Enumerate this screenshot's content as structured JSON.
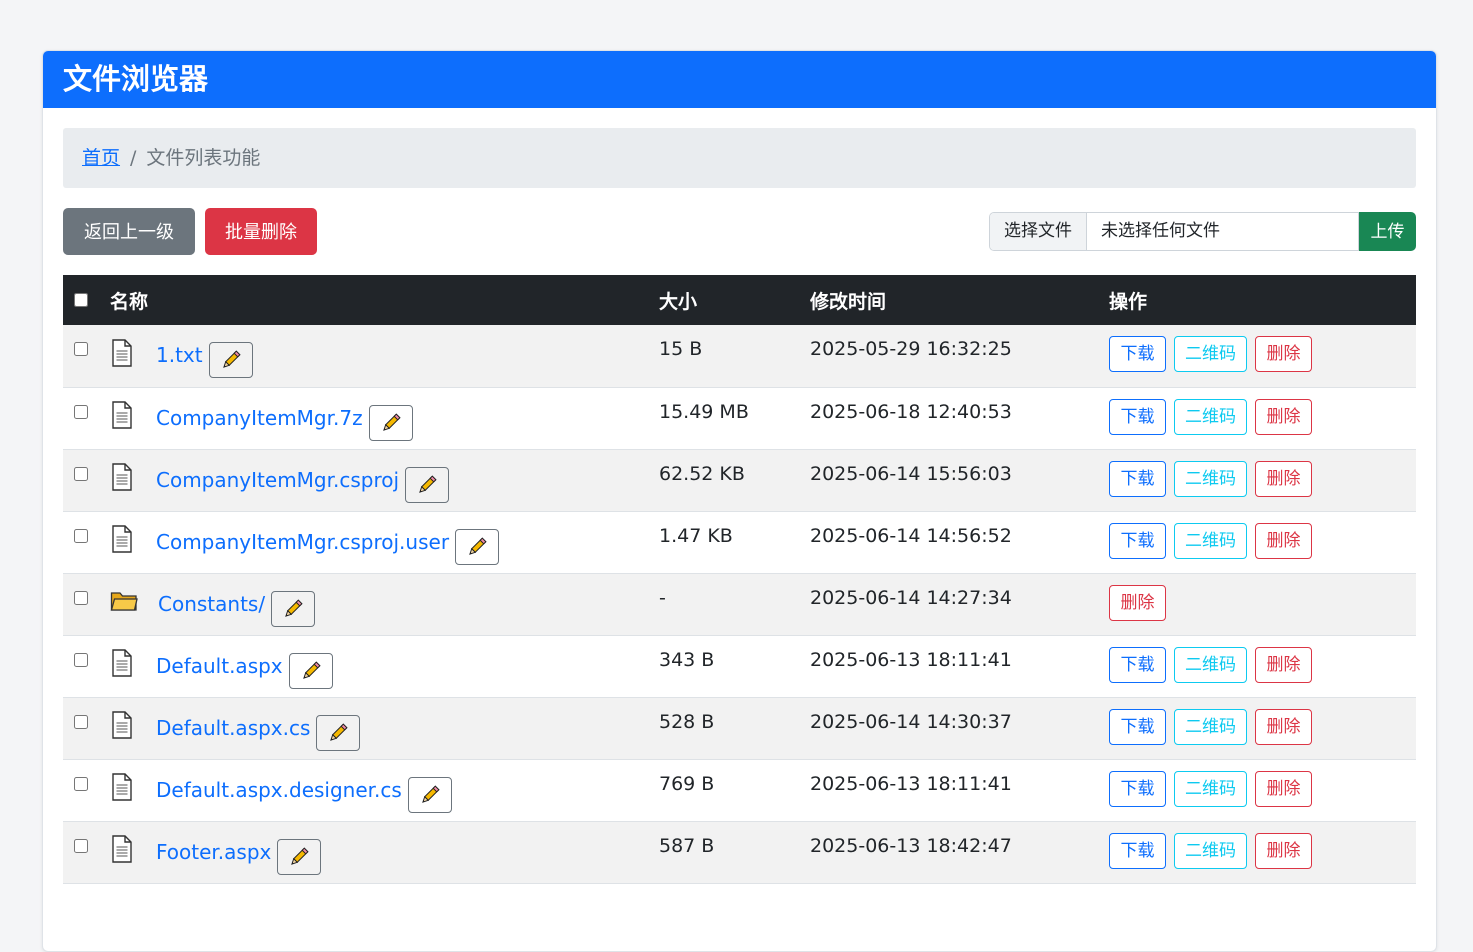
{
  "header": {
    "title": "文件浏览器"
  },
  "breadcrumb": {
    "home": "首页",
    "separator": "/",
    "current": "文件列表功能"
  },
  "toolbar": {
    "back_label": "返回上一级",
    "batch_delete_label": "批量删除",
    "choose_file_label": "选择文件",
    "no_file_label": "未选择任何文件",
    "upload_label": "上传"
  },
  "table": {
    "headers": {
      "name": "名称",
      "size": "大小",
      "modified": "修改时间",
      "actions": "操作"
    },
    "action_labels": {
      "download": "下载",
      "qrcode": "二维码",
      "delete": "删除"
    },
    "rows": [
      {
        "type": "file",
        "icon": "file-icon",
        "name": "1.txt",
        "size": "15 B",
        "modified": "2025-05-29 16:32:25"
      },
      {
        "type": "file",
        "icon": "file-icon",
        "name": "CompanyItemMgr.7z",
        "size": "15.49 MB",
        "modified": "2025-06-18 12:40:53"
      },
      {
        "type": "file",
        "icon": "file-icon",
        "name": "CompanyItemMgr.csproj",
        "size": "62.52 KB",
        "modified": "2025-06-14 15:56:03"
      },
      {
        "type": "file",
        "icon": "file-icon",
        "name": "CompanyItemMgr.csproj.user",
        "size": "1.47 KB",
        "modified": "2025-06-14 14:56:52"
      },
      {
        "type": "folder",
        "icon": "folder-icon",
        "name": "Constants/",
        "size": "-",
        "modified": "2025-06-14 14:27:34"
      },
      {
        "type": "file",
        "icon": "file-icon",
        "name": "Default.aspx",
        "size": "343 B",
        "modified": "2025-06-13 18:11:41"
      },
      {
        "type": "file",
        "icon": "file-icon",
        "name": "Default.aspx.cs",
        "size": "528 B",
        "modified": "2025-06-14 14:30:37"
      },
      {
        "type": "file",
        "icon": "file-icon",
        "name": "Default.aspx.designer.cs",
        "size": "769 B",
        "modified": "2025-06-13 18:11:41"
      },
      {
        "type": "file",
        "icon": "file-icon",
        "name": "Footer.aspx",
        "size": "587 B",
        "modified": "2025-06-13 18:42:47"
      }
    ]
  },
  "colors": {
    "primary": "#0d6efd",
    "secondary": "#6c757d",
    "danger": "#dc3545",
    "success": "#198754",
    "info": "#0dcaf0",
    "table_header": "#212529"
  }
}
